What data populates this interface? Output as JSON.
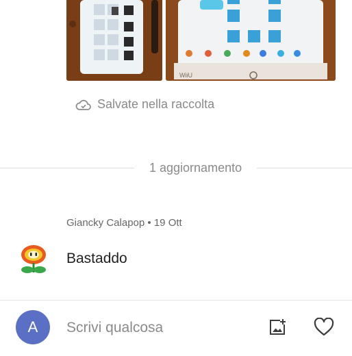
{
  "media": {
    "photo_1_icon": "image-icon",
    "photo_2_icon": "image-icon",
    "photo_2_logo": "WiiU"
  },
  "saved": {
    "icon": "cloud-check-icon",
    "label": "Salvate nella raccolta"
  },
  "updates": {
    "label": "1 aggiornamento"
  },
  "comment": {
    "author": "Giancky Calapop",
    "separator": "•",
    "date": "19 Ott",
    "text": "Bastaddo",
    "avatar_icon": "fire-flower-icon"
  },
  "composer": {
    "avatar_letter": "A",
    "avatar_color": "#5b6fc4",
    "placeholder": "Scrivi qualcosa",
    "add_image_icon": "add-image-icon",
    "like_icon": "heart-outline-icon"
  }
}
